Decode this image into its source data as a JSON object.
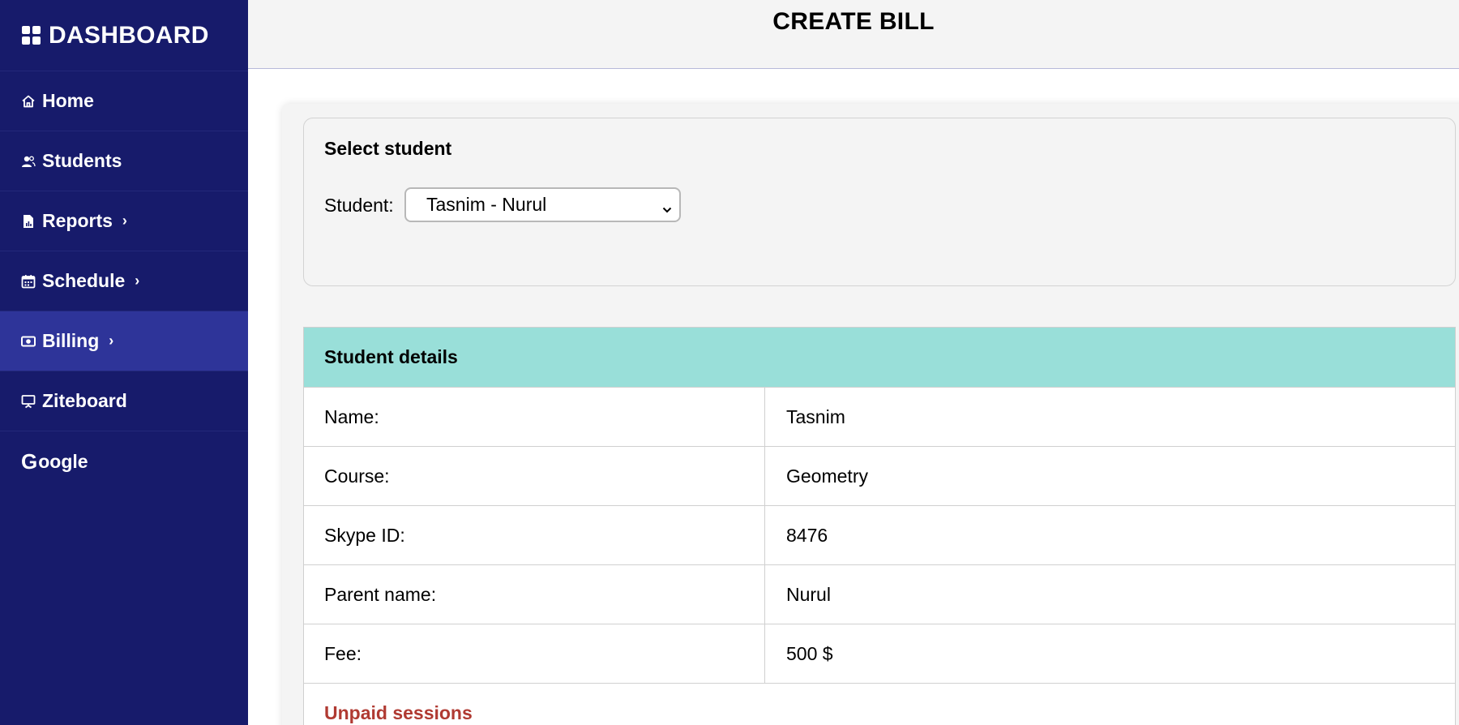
{
  "sidebar": {
    "brand": "DASHBOARD",
    "items": [
      {
        "label": "Home",
        "icon": "home-icon",
        "chevron": false
      },
      {
        "label": "Students",
        "icon": "users-icon",
        "chevron": false
      },
      {
        "label": "Reports",
        "icon": "report-file-icon",
        "chevron": true
      },
      {
        "label": "Schedule",
        "icon": "calendar-icon",
        "chevron": true
      },
      {
        "label": "Billing",
        "icon": "money-icon",
        "chevron": true,
        "active": true
      },
      {
        "label": "Ziteboard",
        "icon": "presentation-board-icon",
        "chevron": false
      },
      {
        "label": "oogle",
        "icon": "google-icon",
        "chevron": false
      }
    ],
    "google_letter": "G",
    "chevron_glyph": "›"
  },
  "header": {
    "title": "CREATE BILL"
  },
  "select_section": {
    "title": "Select student",
    "label": "Student:",
    "selected_value": "Tasnim - Nurul"
  },
  "details": {
    "title": "Student details",
    "rows": [
      {
        "label": "Name:",
        "value": "Tasnim"
      },
      {
        "label": "Course:",
        "value": "Geometry"
      },
      {
        "label": "Skype ID:",
        "value": "8476"
      },
      {
        "label": "Parent name:",
        "value": "Nurul"
      },
      {
        "label": "Fee:",
        "value": "500 $"
      }
    ],
    "unpaid_title": "Unpaid sessions"
  },
  "colors": {
    "sidebar_bg": "#171b6b",
    "sidebar_active": "#2e3499",
    "table_header": "#99dfd9",
    "unpaid_text": "#b03a32"
  }
}
